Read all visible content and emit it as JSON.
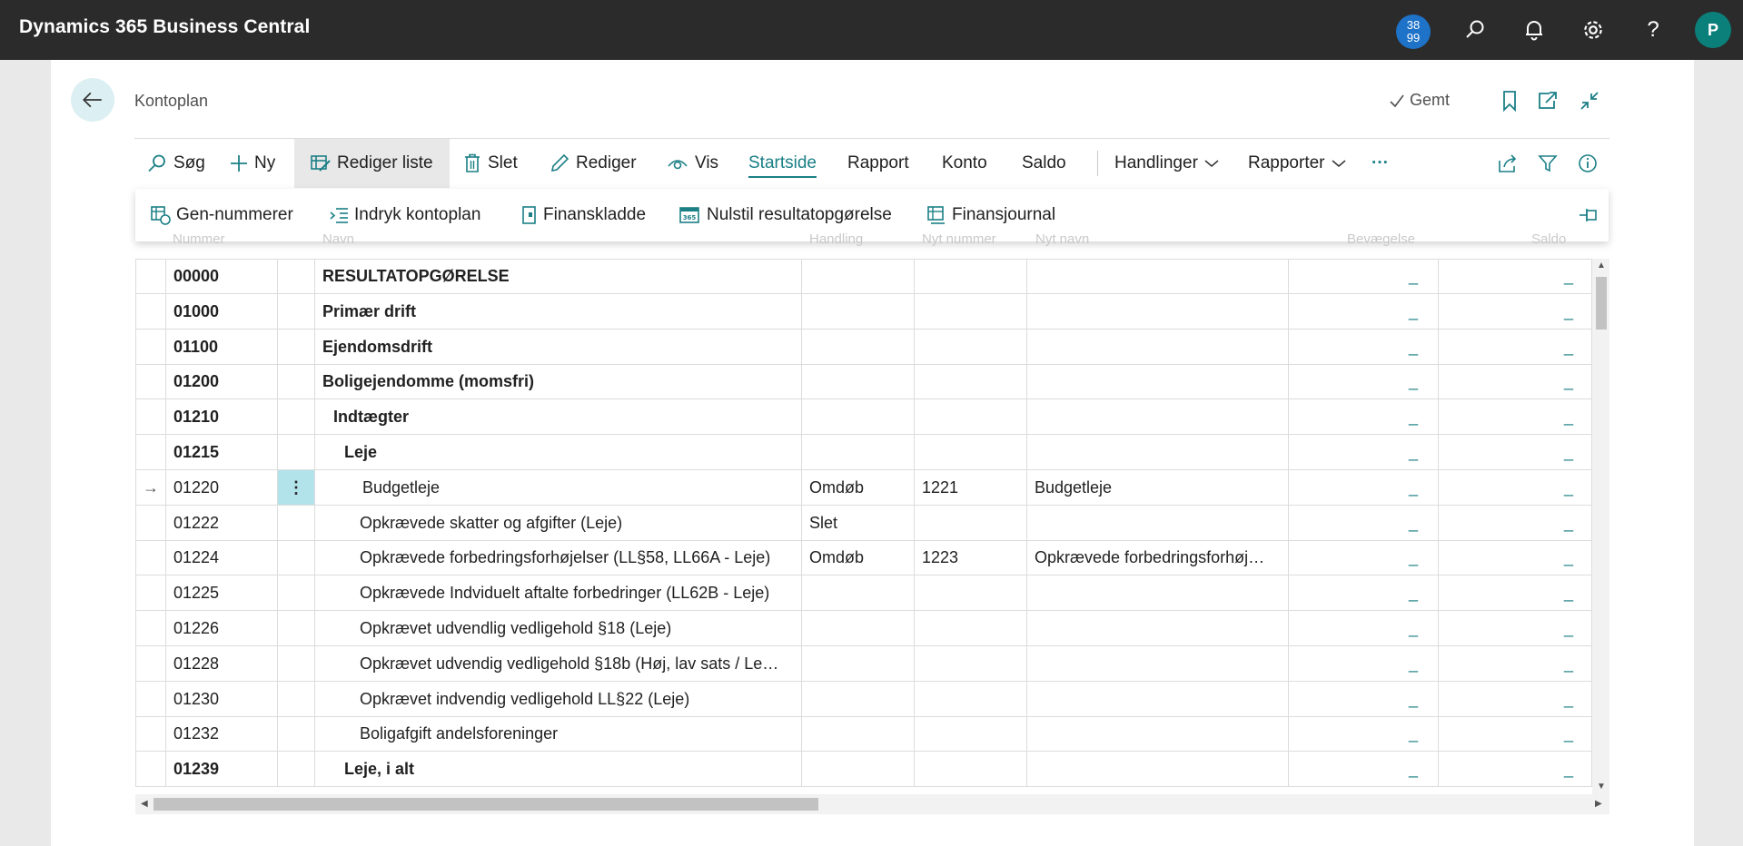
{
  "app": {
    "title": "Dynamics 365 Business Central"
  },
  "topbar": {
    "notification_badge": [
      "38",
      "99"
    ],
    "icons": [
      "search-icon",
      "bell-icon",
      "gear-icon",
      "help-icon"
    ],
    "help_glyph": "?",
    "avatar_initial": "P"
  },
  "header": {
    "page_title": "Kontoplan",
    "saved_label": "Gemt",
    "icons": [
      "bookmark-icon",
      "open-new-window-icon",
      "collapse-icon"
    ]
  },
  "actionbar": {
    "search": "Søg",
    "new": "Ny",
    "edit_list": "Rediger liste",
    "delete": "Slet",
    "edit": "Rediger",
    "view": "Vis",
    "home": "Startside",
    "report": "Rapport",
    "account": "Konto",
    "balance": "Saldo",
    "actions": "Handlinger",
    "reports": "Rapporter",
    "more": "···"
  },
  "promoted": {
    "items": [
      "Gen-nummerer",
      "Indryk kontoplan",
      "Finanskladde",
      "Nulstil resultatopgørelse",
      "Finansjournal"
    ]
  },
  "grid": {
    "headers": [
      "Nummer",
      "Navn",
      "Handling",
      "Nyt nummer",
      "Nyt navn",
      "Bevægelse",
      "Saldo"
    ],
    "rows": [
      {
        "number": "00000",
        "name": "RESULTATOPGØRELSE",
        "indent": 0,
        "bold": true,
        "action": "",
        "new_number": "",
        "new_name": "",
        "budget": "_",
        "saldo": "_"
      },
      {
        "number": "01000",
        "name": "Primær drift",
        "indent": 0,
        "bold": true,
        "action": "",
        "new_number": "",
        "new_name": "",
        "budget": "_",
        "saldo": "_"
      },
      {
        "number": "01100",
        "name": "Ejendomsdrift",
        "indent": 0,
        "bold": true,
        "action": "",
        "new_number": "",
        "new_name": "",
        "budget": "_",
        "saldo": "_"
      },
      {
        "number": "01200",
        "name": "Boligejendomme (momsfri)",
        "indent": 0,
        "bold": true,
        "action": "",
        "new_number": "",
        "new_name": "",
        "budget": "_",
        "saldo": "_"
      },
      {
        "number": "01210",
        "name": "Indtægter",
        "indent": 1,
        "bold": true,
        "action": "",
        "new_number": "",
        "new_name": "",
        "budget": "_",
        "saldo": "_"
      },
      {
        "number": "01215",
        "name": "Leje",
        "indent": 2,
        "bold": true,
        "action": "",
        "new_number": "",
        "new_name": "",
        "budget": "_",
        "saldo": "_"
      },
      {
        "number": "01220",
        "name": "Budgetleje",
        "indent": 3,
        "bold": false,
        "selected": true,
        "action": "Omdøb",
        "new_number": "1221",
        "new_name": "Budgetleje",
        "budget": "_",
        "saldo": "_"
      },
      {
        "number": "01222",
        "name": "Opkrævede skatter og afgifter (Leje)",
        "indent": 3,
        "bold": false,
        "action": "Slet",
        "new_number": "",
        "new_name": "",
        "budget": "_",
        "saldo": "_"
      },
      {
        "number": "01224",
        "name": "Opkrævede forbedringsforhøjelser (LL§58, LL66A - Leje)",
        "indent": 3,
        "bold": false,
        "action": "Omdøb",
        "new_number": "1223",
        "new_name": "Opkrævede forbedringsforhøj…",
        "budget": "_",
        "saldo": "_"
      },
      {
        "number": "01225",
        "name": "Opkrævede Indviduelt aftalte forbedringer (LL62B - Leje)",
        "indent": 3,
        "bold": false,
        "action": "",
        "new_number": "",
        "new_name": "",
        "budget": "_",
        "saldo": "_"
      },
      {
        "number": "01226",
        "name": "Opkrævet udvendlig vedligehold §18 (Leje)",
        "indent": 3,
        "bold": false,
        "action": "",
        "new_number": "",
        "new_name": "",
        "budget": "_",
        "saldo": "_"
      },
      {
        "number": "01228",
        "name": "Opkrævet udvendig vedligehold §18b (Høj, lav sats / Le…",
        "indent": 3,
        "bold": false,
        "action": "",
        "new_number": "",
        "new_name": "",
        "budget": "_",
        "saldo": "_"
      },
      {
        "number": "01230",
        "name": "Opkrævet indvendig vedligehold LL§22 (Leje)",
        "indent": 3,
        "bold": false,
        "action": "",
        "new_number": "",
        "new_name": "",
        "budget": "_",
        "saldo": "_"
      },
      {
        "number": "01232",
        "name": "Boligafgift andelsforeninger",
        "indent": 3,
        "bold": false,
        "action": "",
        "new_number": "",
        "new_name": "",
        "budget": "_",
        "saldo": "_"
      },
      {
        "number": "01239",
        "name": "Leje, i alt",
        "indent": 2,
        "bold": true,
        "action": "",
        "new_number": "",
        "new_name": "",
        "budget": "_",
        "saldo": "_"
      }
    ]
  }
}
